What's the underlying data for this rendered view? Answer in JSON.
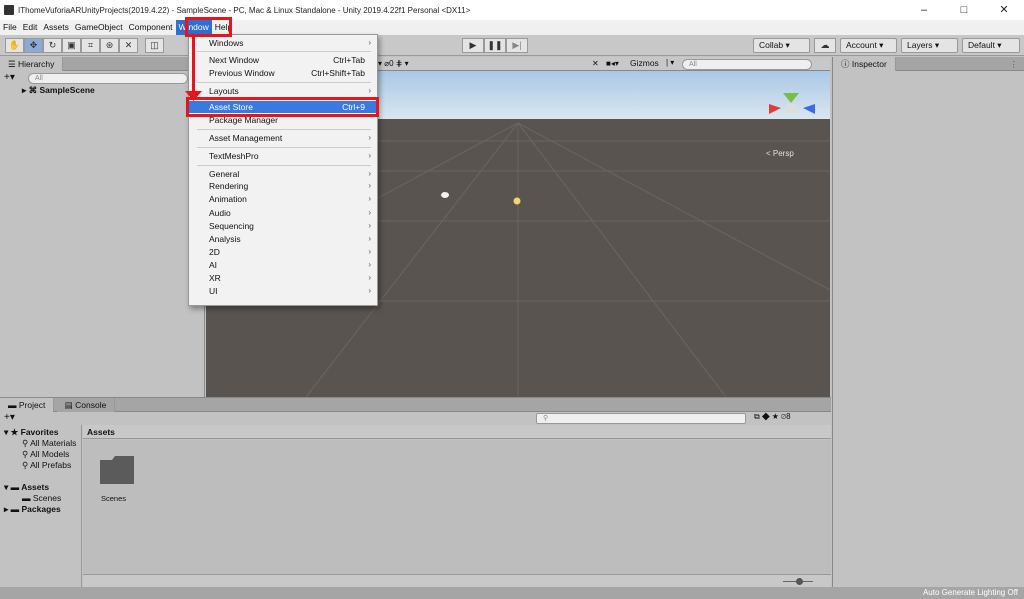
{
  "titlebar": {
    "title": "IThomeVuforiaARUnityProjects(2019.4.22) - SampleScene - PC, Mac & Linux Standalone - Unity 2019.4.22f1 Personal <DX11>",
    "minimize": "–",
    "maximize": "□",
    "close": "✕"
  },
  "menubar": {
    "items": [
      "File",
      "Edit",
      "Assets",
      "GameObject",
      "Component",
      "Window",
      "Help"
    ]
  },
  "toolbar": {
    "collab": "Collab ▾",
    "account": "Account ▾",
    "layers": "Layers ▾",
    "layout": "Default ▾"
  },
  "hierarchy": {
    "tab": "Hierarchy",
    "search": "All",
    "scene": "SampleScene"
  },
  "scene": {
    "gizmos": "Gizmos",
    "search": "All",
    "persp": "< Persp",
    "hidden_count": "0"
  },
  "inspector": {
    "tab": "Inspector"
  },
  "window_menu": {
    "items": [
      {
        "label": "Windows",
        "shortcut": "",
        "arrow": "›"
      },
      {
        "label": "Next Window",
        "shortcut": "Ctrl+Tab",
        "arrow": ""
      },
      {
        "label": "Previous Window",
        "shortcut": "Ctrl+Shift+Tab",
        "arrow": ""
      },
      {
        "label": "Layouts",
        "shortcut": "",
        "arrow": "›"
      },
      {
        "label": "Asset Store",
        "shortcut": "Ctrl+9",
        "arrow": ""
      },
      {
        "label": "Package Manager",
        "shortcut": "",
        "arrow": ""
      },
      {
        "label": "Asset Management",
        "shortcut": "",
        "arrow": "›"
      },
      {
        "label": "TextMeshPro",
        "shortcut": "",
        "arrow": "›"
      },
      {
        "label": "General",
        "shortcut": "",
        "arrow": "›"
      },
      {
        "label": "Rendering",
        "shortcut": "",
        "arrow": "›"
      },
      {
        "label": "Animation",
        "shortcut": "",
        "arrow": "›"
      },
      {
        "label": "Audio",
        "shortcut": "",
        "arrow": "›"
      },
      {
        "label": "Sequencing",
        "shortcut": "",
        "arrow": "›"
      },
      {
        "label": "Analysis",
        "shortcut": "",
        "arrow": "›"
      },
      {
        "label": "2D",
        "shortcut": "",
        "arrow": "›"
      },
      {
        "label": "AI",
        "shortcut": "",
        "arrow": "›"
      },
      {
        "label": "XR",
        "shortcut": "",
        "arrow": "›"
      },
      {
        "label": "UI",
        "shortcut": "",
        "arrow": "›"
      }
    ]
  },
  "project": {
    "tab_project": "Project",
    "tab_console": "Console",
    "favorites": "Favorites",
    "fav_items": [
      "All Materials",
      "All Models",
      "All Prefabs"
    ],
    "assets": "Assets",
    "scenes": "Scenes",
    "packages": "Packages",
    "breadcrumb": "Assets",
    "folder_label": "Scenes",
    "hidden_packages": "8"
  },
  "status": {
    "text": "Auto Generate Lighting Off"
  },
  "colors": {
    "highlight": "#3a7ae0",
    "annotation": "#e8141c"
  }
}
